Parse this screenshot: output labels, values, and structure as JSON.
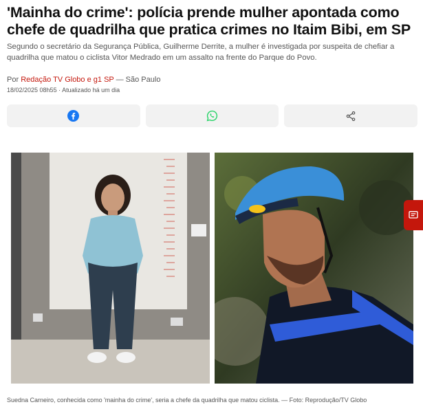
{
  "article": {
    "headline": "'Mainha do crime': polícia prende mulher apontada como chefe de quadrilha que pratica crimes no Itaim Bibi, em SP",
    "subtitle": "Segundo o secretário da Segurança Pública, Guilherme Derrite, a mulher é investigada por suspeita de chefiar a quadrilha que matou o ciclista Vitor Medrado em um assalto na frente do Parque do Povo.",
    "byline": {
      "prefix": "Por",
      "author": "Redação TV Globo e g1 SP",
      "separator": "—",
      "location": "São Paulo"
    },
    "dates": "18/02/2025 08h55 · Atualizado há um dia",
    "caption": "Suedna Carneiro, conhecida como 'mainha do crime', seria a chefe da quadrilha que matou ciclista. — Foto: Reprodução/TV Globo"
  },
  "share": {
    "buttons": [
      {
        "icon": "facebook-icon",
        "color": "#1877f2"
      },
      {
        "icon": "whatsapp-icon",
        "color": "#25d366"
      },
      {
        "icon": "share-icon",
        "color": "#555555"
      }
    ]
  },
  "colors": {
    "accent": "#c4170c",
    "text": "#111111",
    "muted": "#555555",
    "button_bg": "#f2f2f2"
  }
}
